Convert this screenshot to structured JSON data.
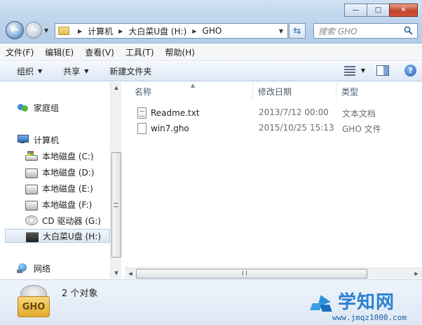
{
  "window": {
    "minimize_glyph": "—",
    "maximize_glyph": "□",
    "close_glyph": "✕"
  },
  "address": {
    "crumbs": [
      "计算机",
      "大白菜U盘 (H:)",
      "GHO"
    ]
  },
  "search": {
    "placeholder": "搜索 GHO"
  },
  "menu": [
    "文件(F)",
    "编辑(E)",
    "查看(V)",
    "工具(T)",
    "帮助(H)"
  ],
  "toolbar": {
    "organize": "组织",
    "share": "共享",
    "new_folder": "新建文件夹"
  },
  "sidebar": {
    "homegroup": "家庭组",
    "computer": "计算机",
    "drives": [
      {
        "label": "本地磁盘 (C:)",
        "icon": "windows-drive-icon"
      },
      {
        "label": "本地磁盘 (D:)",
        "icon": "hard-drive-icon"
      },
      {
        "label": "本地磁盘 (E:)",
        "icon": "hard-drive-icon"
      },
      {
        "label": "本地磁盘 (F:)",
        "icon": "hard-drive-icon"
      },
      {
        "label": "CD 驱动器 (G:)",
        "icon": "cd-drive-icon"
      },
      {
        "label": "大白菜U盘 (H:)",
        "icon": "usb-drive-icon",
        "selected": true
      }
    ],
    "network": "网络"
  },
  "columns": {
    "name": "名称",
    "date": "修改日期",
    "type": "类型"
  },
  "files": [
    {
      "name": "Readme.txt",
      "date": "2013/7/12 00:00",
      "type": "文本文档",
      "icon": "text-document-icon"
    },
    {
      "name": "win7.gho",
      "date": "2015/10/25 15:13",
      "type": "GHO 文件",
      "icon": "file-icon"
    }
  ],
  "details": {
    "icon_label": "GHO",
    "count": "2 个对象"
  },
  "watermark": {
    "brand": "学知网",
    "url": "www.jmqz1000.com"
  },
  "colors": {
    "chrome_blue": "#bcd3ec",
    "accent": "#2a7fd0"
  }
}
